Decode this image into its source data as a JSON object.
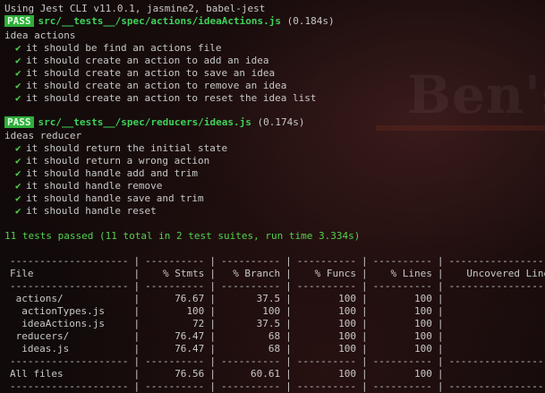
{
  "header": "Using Jest CLI v11.0.1, jasmine2, babel-jest",
  "suites": [
    {
      "badge": "PASS",
      "path": "src/__tests__/spec/actions/ideaActions.js",
      "time": "(0.184s)",
      "group": "idea actions",
      "tests": [
        "it should be find an actions file",
        "it should create an action to add an idea",
        "it should create an action to save an idea",
        "it should create an action to remove an idea",
        "it should create an action to reset the idea list"
      ]
    },
    {
      "badge": "PASS",
      "path": "src/__tests__/spec/reducers/ideas.js",
      "time": "(0.174s)",
      "group": "ideas reducer",
      "tests": [
        "it should return the initial state",
        "it should return a wrong action",
        "it should handle add and trim",
        "it should handle remove",
        "it should handle save and trim",
        "it should handle reset"
      ]
    }
  ],
  "check_icon": "✔",
  "summary": "11 tests passed (11 total in 2 test suites, run time 3.334s)",
  "coverage": {
    "separator": [
      "--------------------",
      "----------",
      "----------",
      "----------",
      "----------",
      "------------------"
    ],
    "headers": [
      "File",
      "% Stmts",
      "% Branch",
      "% Funcs",
      "% Lines",
      "Uncovered Lines"
    ],
    "rows": [
      {
        "file": " actions/",
        "stmts": "76.67",
        "branch": "37.5",
        "funcs": "100",
        "lines": "100",
        "uncovered": ""
      },
      {
        "file": "  actionTypes.js",
        "stmts": "100",
        "branch": "100",
        "funcs": "100",
        "lines": "100",
        "uncovered": ""
      },
      {
        "file": "  ideaActions.js",
        "stmts": "72",
        "branch": "37.5",
        "funcs": "100",
        "lines": "100",
        "uncovered": ""
      },
      {
        "file": " reducers/",
        "stmts": "76.47",
        "branch": "68",
        "funcs": "100",
        "lines": "100",
        "uncovered": ""
      },
      {
        "file": "  ideas.js",
        "stmts": "76.47",
        "branch": "68",
        "funcs": "100",
        "lines": "100",
        "uncovered": ""
      }
    ],
    "all": {
      "file": "All files",
      "stmts": "76.56",
      "branch": "60.61",
      "funcs": "100",
      "lines": "100",
      "uncovered": ""
    }
  },
  "watermark": "Ben's"
}
